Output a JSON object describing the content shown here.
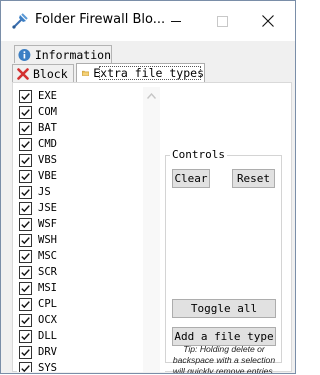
{
  "window": {
    "title": "Folder Firewall Blo..."
  },
  "titlebar_buttons": {
    "minimize": "minimize",
    "maximize": "maximize",
    "close": "close"
  },
  "tabs": [
    {
      "label": "Information",
      "icon": "info-icon"
    },
    {
      "label": "Block",
      "icon": "red-x-icon"
    },
    {
      "label": "Extra file types",
      "icon": "folder-icon",
      "selected": true
    }
  ],
  "extensions": [
    {
      "label": "EXE",
      "checked": true
    },
    {
      "label": "COM",
      "checked": true
    },
    {
      "label": "BAT",
      "checked": true
    },
    {
      "label": "CMD",
      "checked": true
    },
    {
      "label": "VBS",
      "checked": true
    },
    {
      "label": "VBE",
      "checked": true
    },
    {
      "label": "JS",
      "checked": true
    },
    {
      "label": "JSE",
      "checked": true
    },
    {
      "label": "WSF",
      "checked": true
    },
    {
      "label": "WSH",
      "checked": true
    },
    {
      "label": "MSC",
      "checked": true
    },
    {
      "label": "SCR",
      "checked": true
    },
    {
      "label": "MSI",
      "checked": true
    },
    {
      "label": "CPL",
      "checked": true
    },
    {
      "label": "OCX",
      "checked": true
    },
    {
      "label": "DLL",
      "checked": true
    },
    {
      "label": "DRV",
      "checked": true
    },
    {
      "label": "SYS",
      "checked": true
    }
  ],
  "controls": {
    "title": "Controls",
    "clear_label": "Clear",
    "reset_label": "Reset",
    "toggle_all_label": "Toggle all",
    "add_label": "Add a file type",
    "tip": "Tip: Holding delete or backspace with a selection will quickly remove entries."
  },
  "colors": {
    "accent_blue": "#3c7fc4",
    "close_red": "#d33030",
    "folder_yellow": "#e6b84a",
    "checkbox_border": "#333333"
  }
}
